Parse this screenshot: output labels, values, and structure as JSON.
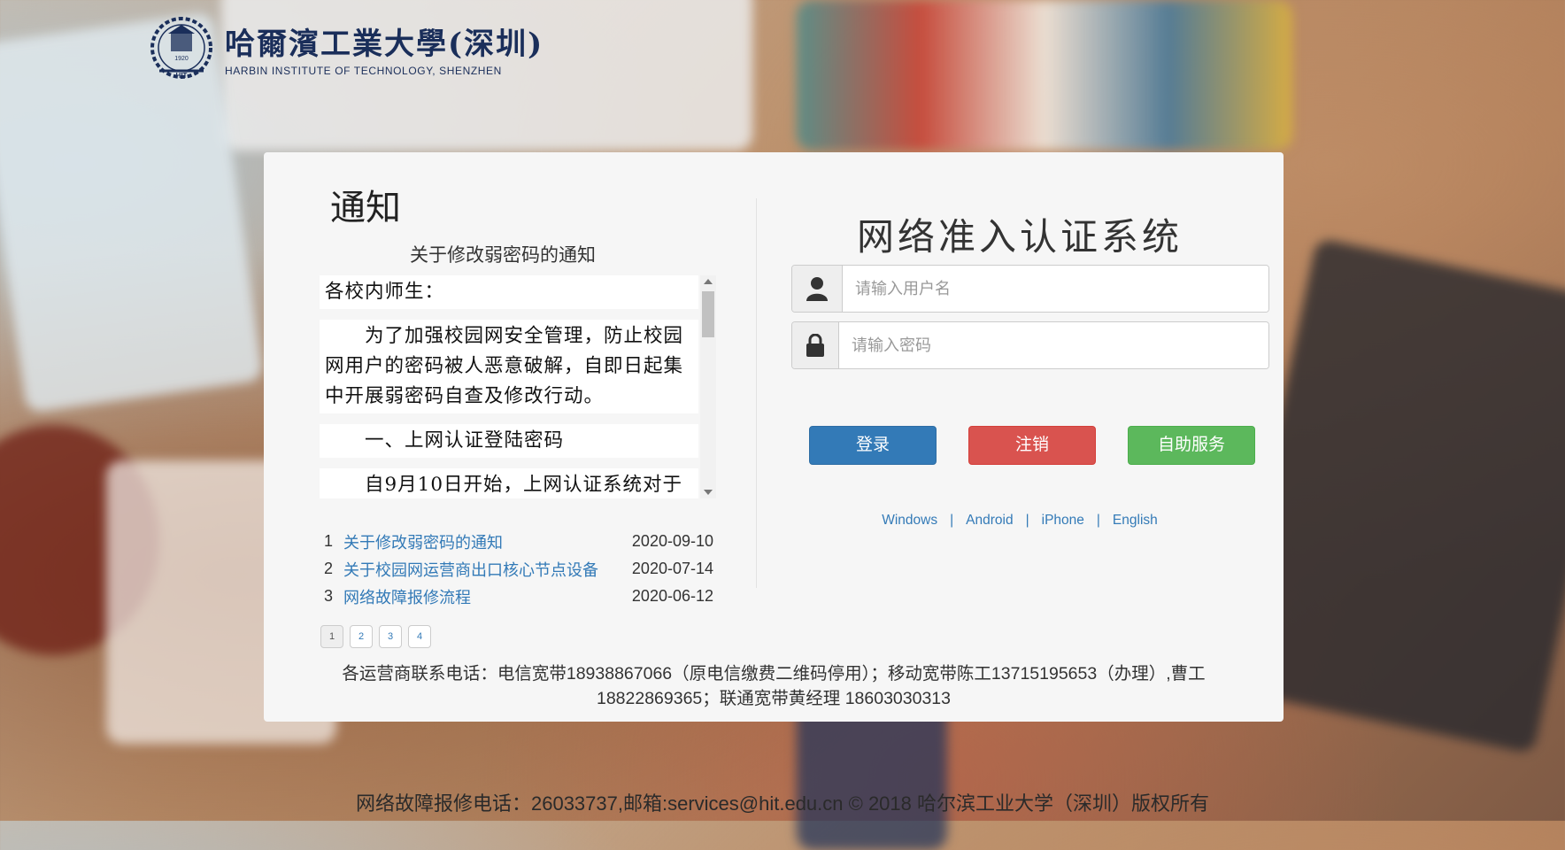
{
  "header": {
    "logo_cn": "哈爾濱工業大學(深圳)",
    "logo_en": "HARBIN INSTITUTE OF TECHNOLOGY, SHENZHEN",
    "emblem_text": "HIT",
    "emblem_year": "1920"
  },
  "notice": {
    "title": "通知",
    "subtitle": "关于修改弱密码的通知",
    "paragraphs": [
      "各校内师生：",
      "　　为了加强校园网安全管理，防止校园网用户的密码被人恶意破解，自即日起集中开展弱密码自查及修改行动。",
      "　　一、上网认证登陆密码",
      "　　自9月10日开始，上网认证系统对于"
    ],
    "list": [
      {
        "num": "1",
        "title": "关于修改弱密码的通知",
        "date": "2020-09-10"
      },
      {
        "num": "2",
        "title": "关于校园网运营商出口核心节点设备",
        "date": "2020-07-14"
      },
      {
        "num": "3",
        "title": "网络故障报修流程",
        "date": "2020-06-12"
      }
    ],
    "pages": [
      "1",
      "2",
      "3",
      "4"
    ]
  },
  "contact": {
    "line1": "各运营商联系电话：电信宽带18938867066（原电信缴费二维码停用）；移动宽带陈工13715195653（办理）,曹工",
    "line2": "18822869365；联通宽带黄经理 18603030313"
  },
  "login": {
    "title": "网络准入认证系统",
    "username_placeholder": "请输入用户名",
    "password_placeholder": "请输入密码",
    "login_label": "登录",
    "logout_label": "注销",
    "self_service_label": "自助服务",
    "links": [
      "Windows",
      "Android",
      "iPhone",
      "English"
    ],
    "colors": {
      "primary": "#337ab7",
      "danger": "#d9534f",
      "success": "#5cb85c"
    }
  },
  "footer": {
    "text": "网络故障报修电话：26033737,邮箱:services@hit.edu.cn © 2018 哈尔滨工业大学（深圳）版权所有"
  }
}
